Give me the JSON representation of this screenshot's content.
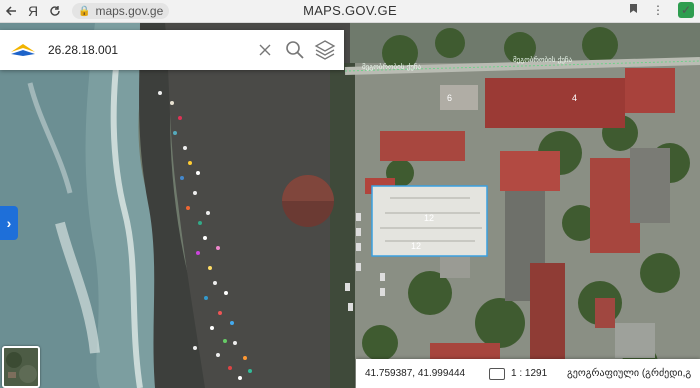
{
  "browser": {
    "back_icon": "arrow-left-icon",
    "yandex_label": "Я",
    "reload_icon": "reload-icon",
    "url": "maps.gov.ge",
    "title": "MAPS.GOV.GE",
    "menu_icon": "more-vertical-icon"
  },
  "search": {
    "value": "26.28.18.001",
    "clear_icon": "close-icon",
    "search_icon": "search-icon",
    "layers_icon": "layers-icon"
  },
  "map": {
    "street_labels": [
      "მეგობრობის ქუჩა",
      "მეგობრობის ქუჩა"
    ],
    "building_numbers": [
      "6",
      "4",
      "12",
      "12"
    ]
  },
  "status": {
    "coordinates": "41.759387, 41.999444",
    "scale": "1 : 1291",
    "projection": "გეოგრაფიული (გრძედი,გ"
  }
}
